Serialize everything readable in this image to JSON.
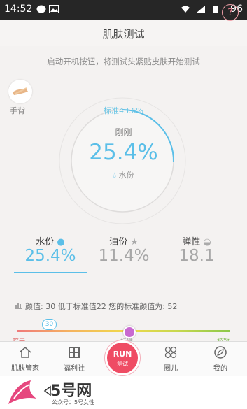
{
  "status_bar": {
    "time": "14:52",
    "battery": "96"
  },
  "header": {
    "title": "肌肤测试",
    "help": "?"
  },
  "instruction": "启动开机按钮，将测试头紧贴皮肤开始测试",
  "body_part": {
    "label": "手背"
  },
  "gauge": {
    "standard": "标准43.6%",
    "time_label": "刚刚",
    "value": "25.4%",
    "metric_label": "水份",
    "level_fraction": 0.254
  },
  "stats": [
    {
      "label": "水份",
      "value": "25.4%"
    },
    {
      "label": "油份",
      "value": "11.4%"
    },
    {
      "label": "弹性",
      "value": "18.1"
    }
  ],
  "face_value": {
    "text": "颜值: 30 低于标准值22 您的标准颜值为: 52"
  },
  "scale": {
    "bubble": "30",
    "left": "暗干",
    "mid": "标准",
    "right": "极致"
  },
  "nav": {
    "items": [
      {
        "label": "肌肤管家"
      },
      {
        "label": "福利社"
      },
      {
        "label": "圈儿"
      },
      {
        "label": "我的"
      }
    ],
    "run_label": "RUN",
    "run_sub": "测试"
  },
  "watermark": {
    "brand": "5号网",
    "sub": "公众号：5号女性"
  },
  "colors": {
    "accent": "#5bbfe8",
    "run": "#ef4c64"
  }
}
